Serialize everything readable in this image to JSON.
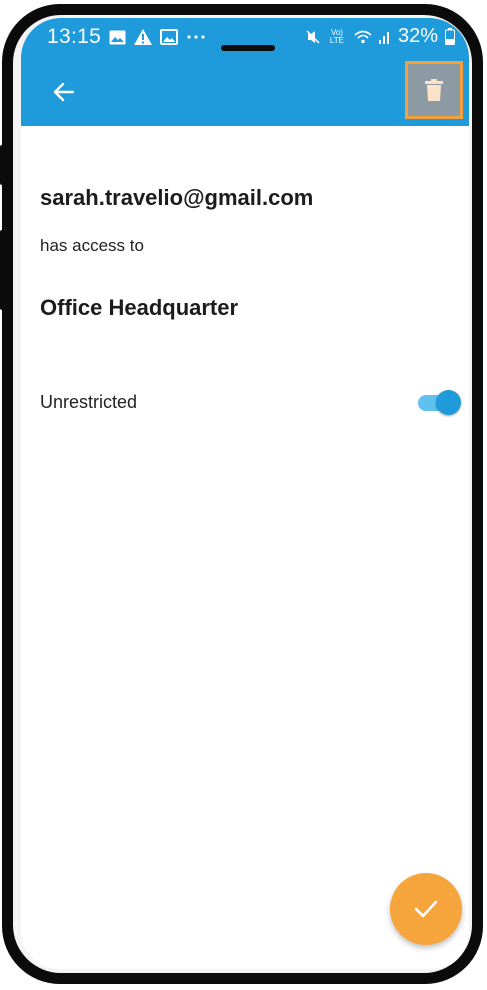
{
  "status_bar": {
    "time": "13:15",
    "left_icons": [
      "gallery-icon",
      "warning-icon",
      "image-icon",
      "more-dots-icon"
    ],
    "network": "Vo) LTE",
    "battery": "32%"
  },
  "app_bar": {
    "background": "#1f9bdc",
    "back_icon": "arrow-left-icon",
    "delete_icon": "trash-icon",
    "highlight_color": "#f5a03a"
  },
  "detail": {
    "email": "sarah.travelio@gmail.com",
    "access_text": "has access to",
    "place": "Office Headquarter",
    "restriction_label": "Unrestricted",
    "restriction_on": true
  },
  "fab": {
    "icon": "check-icon",
    "color": "#f6a53d"
  }
}
